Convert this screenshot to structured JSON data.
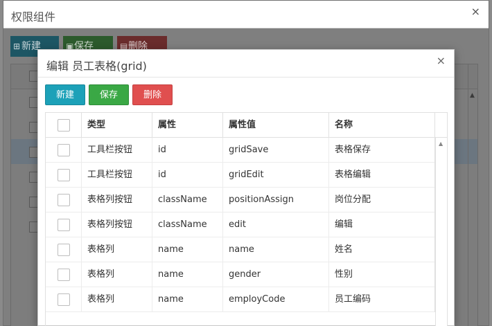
{
  "outer": {
    "title": "权限组件",
    "close": "×",
    "toolbar": {
      "new_label": "新建",
      "save_label": "保存",
      "delete_label": "删除"
    }
  },
  "dialog": {
    "title": "编辑 员工表格(grid)",
    "close": "×",
    "toolbar": {
      "new_label": "新建",
      "save_label": "保存",
      "delete_label": "删除"
    },
    "grid": {
      "columns": [
        "类型",
        "属性",
        "属性值",
        "名称"
      ],
      "rows": [
        {
          "type": "工具栏按钮",
          "attr": "id",
          "value": "gridSave",
          "name": "表格保存"
        },
        {
          "type": "工具栏按钮",
          "attr": "id",
          "value": "gridEdit",
          "name": "表格编辑"
        },
        {
          "type": "表格列按钮",
          "attr": "className",
          "value": "positionAssign",
          "name": "岗位分配"
        },
        {
          "type": "表格列按钮",
          "attr": "className",
          "value": "edit",
          "name": "编辑"
        },
        {
          "type": "表格列",
          "attr": "name",
          "value": "name",
          "name": "姓名"
        },
        {
          "type": "表格列",
          "attr": "name",
          "value": "gender",
          "name": "性别"
        },
        {
          "type": "表格列",
          "attr": "name",
          "value": "employCode",
          "name": "员工编码"
        }
      ]
    }
  },
  "colors": {
    "new": "#1ca1b8",
    "save": "#3aa845",
    "delete": "#e04f4f"
  }
}
